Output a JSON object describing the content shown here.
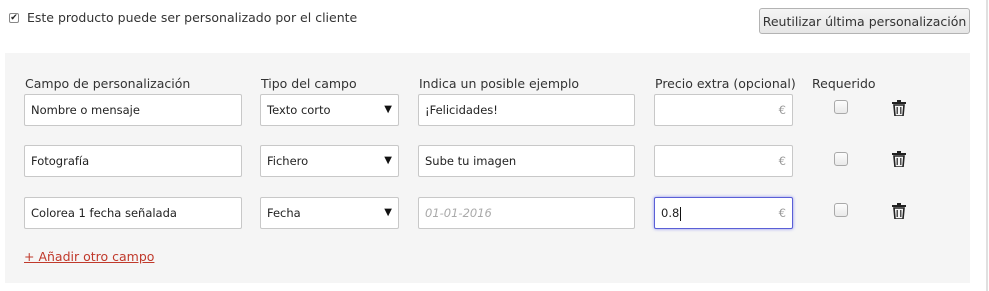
{
  "customizable": {
    "checked": true,
    "label": "Este producto puede ser personalizado por el cliente"
  },
  "reuse_button_label": "Reutilizar última personalización",
  "columns": {
    "field": "Campo de personalización",
    "type": "Tipo del campo",
    "example": "Indica un posible ejemplo",
    "price": "Precio extra (opcional)",
    "required": "Requerido"
  },
  "currency_symbol": "€",
  "rows": [
    {
      "name": "Nombre o mensaje",
      "type": "Texto corto",
      "example": "¡Felicidades!",
      "example_placeholder": "",
      "price": "",
      "required": false
    },
    {
      "name": "Fotografía",
      "type": "Fichero",
      "example": "Sube tu imagen",
      "example_placeholder": "",
      "price": "",
      "required": false
    },
    {
      "name": "Colorea 1 fecha señalada",
      "type": "Fecha",
      "example": "",
      "example_placeholder": "01-01-2016",
      "price": "0.8",
      "required": false
    }
  ],
  "add_field_link": "+ Añadir otro campo",
  "colors": {
    "panel_bg": "#f5f5f5",
    "link": "#c0392b",
    "focus_border": "#5a5fd6"
  }
}
